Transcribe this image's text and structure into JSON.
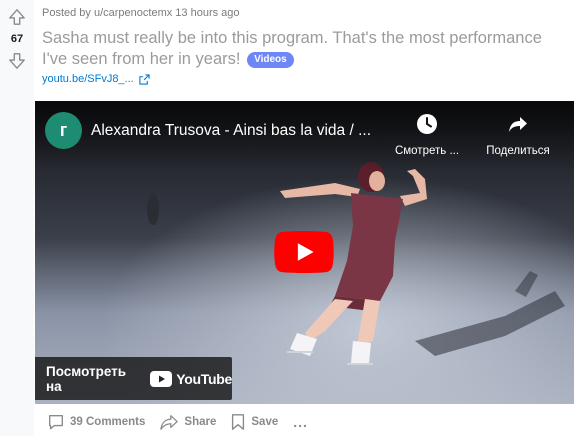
{
  "vote": {
    "count": "67"
  },
  "post": {
    "meta": "Posted by u/carpenoctemx 13 hours ago",
    "title": "Sasha must really be into this program. That's the most performance I've seen from her in years!",
    "flair": "Videos",
    "link_text": "youtu.be/SFvJ8_..."
  },
  "video": {
    "channel_initial": "г",
    "title": "Alexandra Trusova - Ainsi bas la vida / ...",
    "watch_later_label": "Смотреть ...",
    "share_label": "Поделиться",
    "watch_on_label": "Посмотреть на",
    "youtube_wordmark": "YouTube"
  },
  "actions": {
    "comments": "39 Comments",
    "share": "Share",
    "save": "Save",
    "more": "..."
  },
  "colors": {
    "flair_bg": "#6e86f6",
    "link": "#0079d3",
    "youtube_red": "#ff0000",
    "channel_avatar": "#1e8c72"
  },
  "icons": [
    "upvote-arrow-icon",
    "downvote-arrow-icon",
    "external-link-icon",
    "clock-icon",
    "share-arrow-icon",
    "play-icon",
    "youtube-logo-icon",
    "comment-icon",
    "share-icon",
    "bookmark-icon",
    "more-dots-icon"
  ]
}
